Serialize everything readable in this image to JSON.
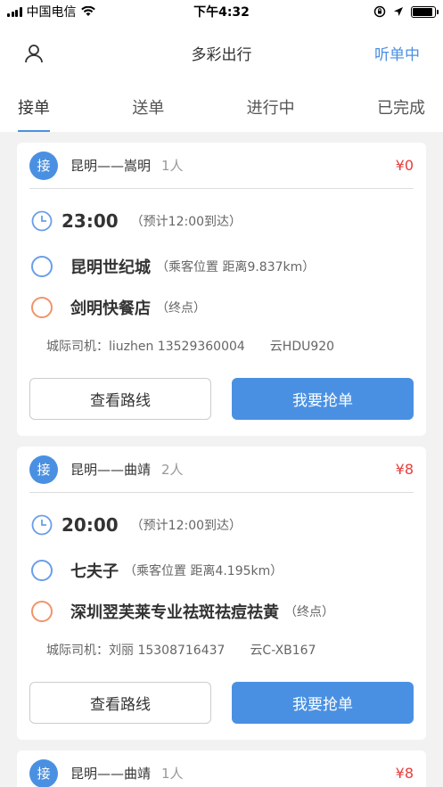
{
  "status_bar": {
    "carrier": "中国电信",
    "time": "下午4:32"
  },
  "nav": {
    "title": "多彩出行",
    "right_label": "听单中"
  },
  "tabs": [
    {
      "label": "接单",
      "active": true
    },
    {
      "label": "送单",
      "active": false
    },
    {
      "label": "进行中",
      "active": false
    },
    {
      "label": "已完成",
      "active": false
    }
  ],
  "orders": [
    {
      "badge": "接",
      "route": "昆明——嵩明",
      "people": "1人",
      "price": "¥0",
      "time": "23:00",
      "eta": "（预计12:00到达）",
      "start_name": "昆明世纪城",
      "start_note": "（乘客位置 距离9.837km）",
      "end_name": "剑明快餐店",
      "end_note": "（终点）",
      "driver": "城际司机：liuzhen 13529360004",
      "plate": "云HDU920",
      "view_route_label": "查看路线",
      "grab_label": "我要抢单"
    },
    {
      "badge": "接",
      "route": "昆明——曲靖",
      "people": "2人",
      "price": "¥8",
      "time": "20:00",
      "eta": "（预计12:00到达）",
      "start_name": "七夫子",
      "start_note": "（乘客位置 距离4.195km）",
      "end_name": "深圳翌芙莱专业祛斑祛痘祛黄",
      "end_note": "（终点）",
      "driver": "城际司机：刘丽 15308716437",
      "plate": "云C-XB167",
      "view_route_label": "查看路线",
      "grab_label": "我要抢单"
    },
    {
      "badge": "接",
      "route": "昆明——曲靖",
      "people": "1人",
      "price": "¥8"
    }
  ],
  "colors": {
    "accent": "#4a90e2",
    "price": "#e83c3c",
    "end_dot": "#f0946b"
  }
}
